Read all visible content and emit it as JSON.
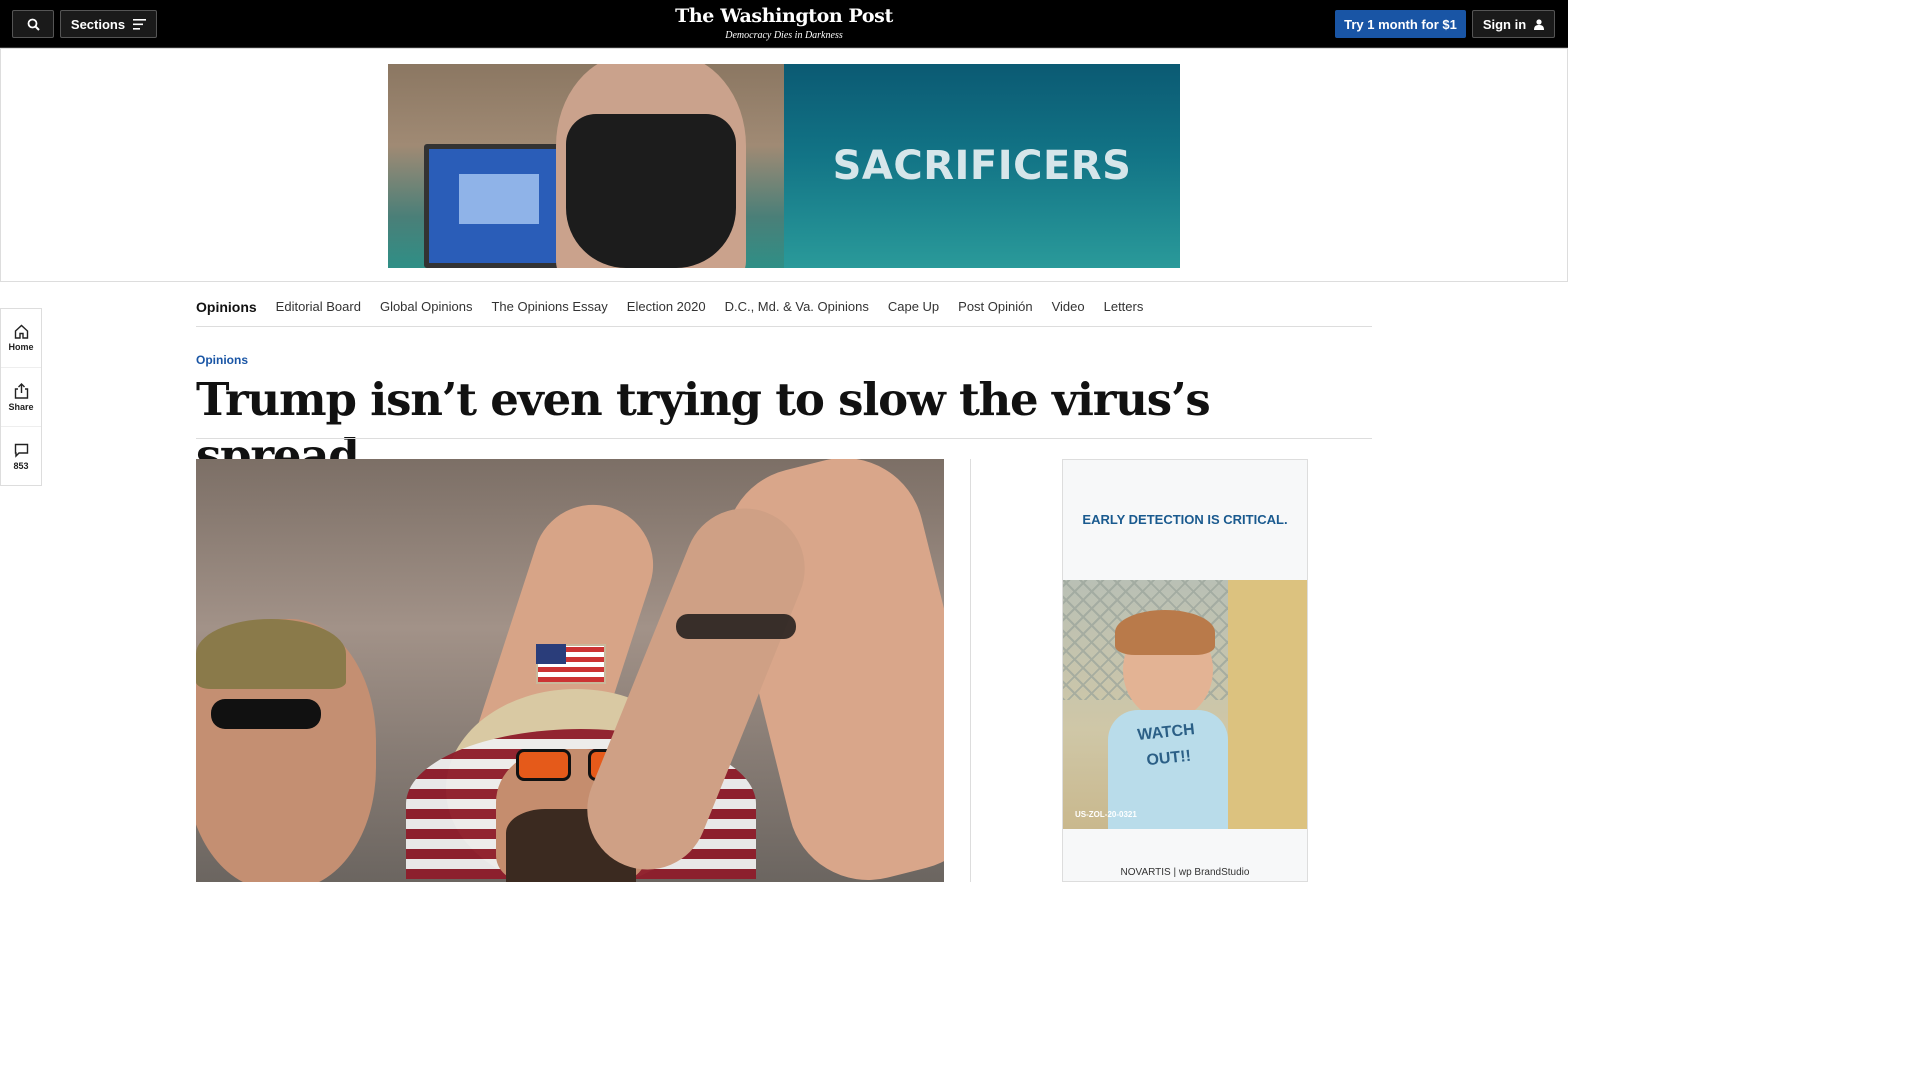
{
  "header": {
    "sections_label": "Sections",
    "logo": "The Washington Post",
    "tagline": "Democracy Dies in Darkness",
    "subscribe_label": "Try 1 month for $1",
    "signin_label": "Sign in"
  },
  "banner_ad": {
    "text": "SACRIFICERS"
  },
  "left_rail": {
    "home_label": "Home",
    "share_label": "Share",
    "comments_count": "853"
  },
  "section_nav": {
    "home": "Opinions",
    "items": [
      "Editorial Board",
      "Global Opinions",
      "The Opinions Essay",
      "Election 2020",
      "D.C., Md. & Va. Opinions",
      "Cape Up",
      "Post Opinión",
      "Video",
      "Letters"
    ]
  },
  "article": {
    "kicker": "Opinions",
    "headline": "Trump isn’t even trying to slow the virus’s spread"
  },
  "side_ad": {
    "headline": "EARLY DETECTION IS CRITICAL.",
    "shirt_text": "WATCH OUT!!",
    "code": "US-ZOL-20-0321",
    "brand": "NOVARTIS | wp BrandStudio"
  },
  "colors": {
    "accent": "#1955a5",
    "topbar": "#000000"
  }
}
